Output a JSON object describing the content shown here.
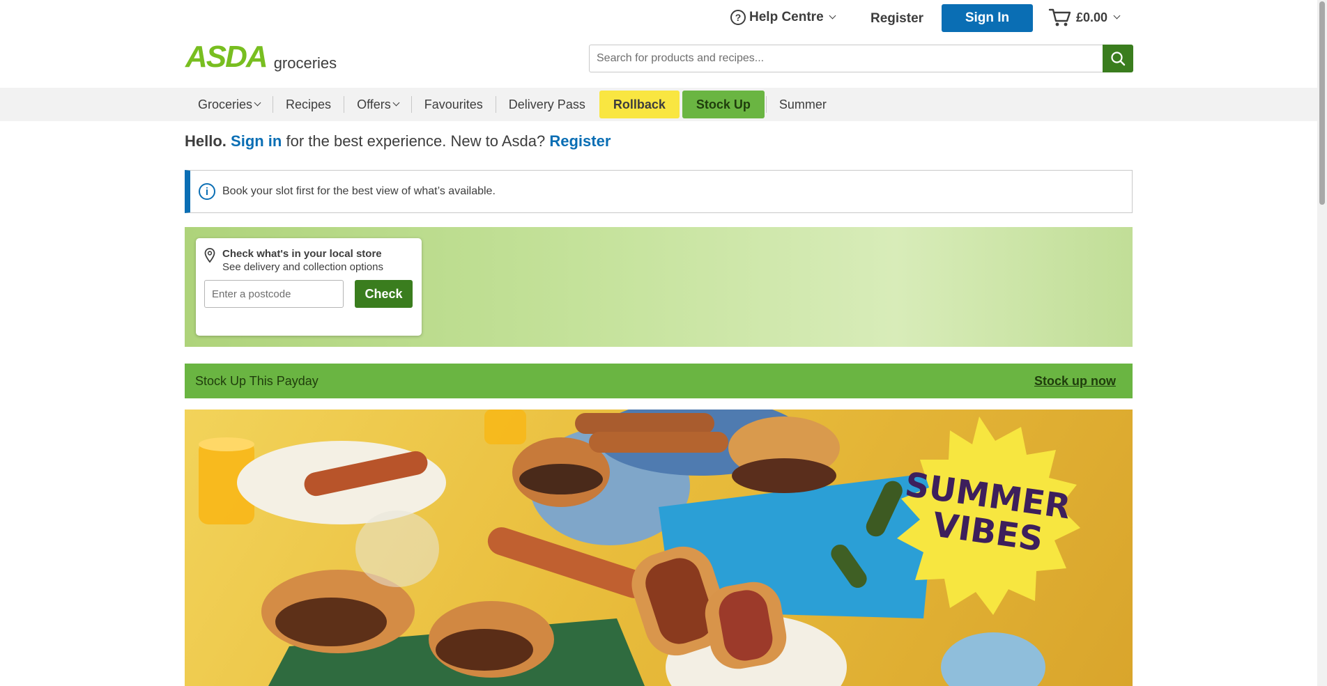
{
  "topbar": {
    "help_label": "Help Centre",
    "register_label": "Register",
    "signin_label": "Sign In",
    "basket_total": "£0.00"
  },
  "header": {
    "logo_text": "ASDA",
    "logo_sub": "groceries",
    "search_placeholder": "Search for products and recipes..."
  },
  "nav": {
    "items": [
      {
        "label": "Groceries"
      },
      {
        "label": "Recipes"
      },
      {
        "label": "Offers"
      },
      {
        "label": "Favourites"
      },
      {
        "label": "Delivery Pass"
      },
      {
        "label": "Rollback"
      },
      {
        "label": "Stock Up"
      },
      {
        "label": "Summer"
      }
    ]
  },
  "greeting": {
    "hello": "Hello.",
    "signin_link": "Sign in",
    "middle": " for the best experience. New to Asda? ",
    "register_link": "Register"
  },
  "info_banner": {
    "text": "Book your slot first for the best view of what’s available."
  },
  "store_check": {
    "title": "Check what's in your local store",
    "subtitle": "See delivery and collection options",
    "postcode_placeholder": "Enter a postcode",
    "button_label": "Check"
  },
  "promo": {
    "title": "Stock Up This Payday",
    "link": "Stock up now"
  },
  "hero": {
    "badge_line1": "SUMMER",
    "badge_line2": "VIBES"
  },
  "colors": {
    "brand_green": "#78be20",
    "dark_green": "#3a7d1e",
    "accent_blue": "#0a6eb4",
    "rollback_yellow": "#f9e641",
    "stockup_green": "#6ab542"
  }
}
